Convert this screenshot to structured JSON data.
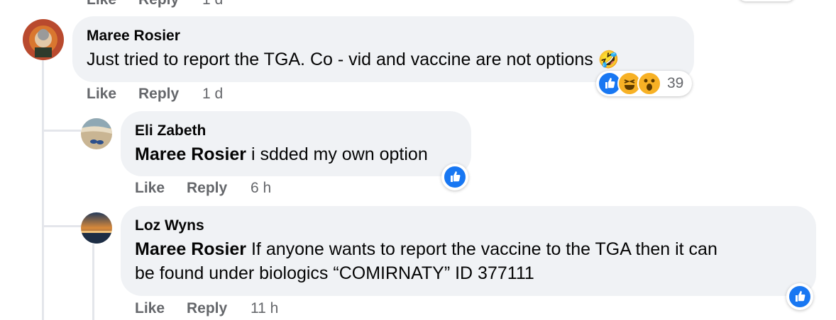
{
  "top_partial": {
    "like": "Like",
    "reply": "Reply",
    "time": "1 d"
  },
  "comments": [
    {
      "author": "Maree Rosier",
      "text": "Just tried to report the TGA. Co - vid and vaccine are not options",
      "emoji": "🤣",
      "like": "Like",
      "reply": "Reply",
      "time": "1 d",
      "reactions": {
        "types": [
          "like-icon",
          "laugh-icon",
          "wow-icon"
        ],
        "count": "39"
      }
    },
    {
      "author": "Eli Zabeth",
      "mention": "Maree Rosier",
      "text": " i sdded my own option",
      "like": "Like",
      "reply": "Reply",
      "time": "6 h",
      "reactions": {
        "types": [
          "like-icon"
        ]
      }
    },
    {
      "author": "Loz Wyns",
      "mention": "Maree Rosier",
      "text_line1": " If anyone wants to report the vaccine to the TGA then it can",
      "text_line2": "be found under biologics “COMIRNATY” ID 377111",
      "like": "Like",
      "reply": "Reply",
      "time": "11 h",
      "reactions": {
        "types": [
          "like-icon"
        ]
      }
    }
  ],
  "colors": {
    "bubble": "#f0f2f5",
    "meta": "#65676b",
    "like_blue": "#1877f2",
    "thread_line": "#e4e6eb"
  }
}
